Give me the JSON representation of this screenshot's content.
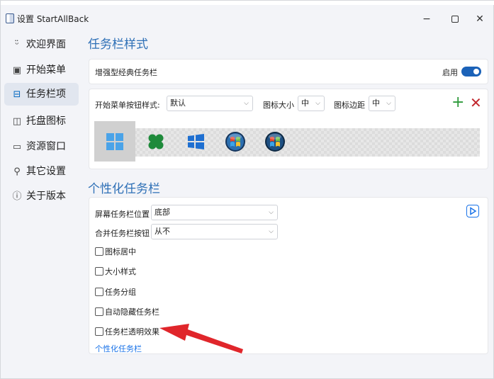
{
  "window": {
    "title": "设置 StartAllBack",
    "minimize": "−",
    "close": "✕"
  },
  "sidebar": {
    "items": [
      {
        "label": "欢迎界面",
        "icon": "smile-icon",
        "glyph": "ᵕ̈"
      },
      {
        "label": "开始菜单",
        "icon": "start-menu-icon",
        "glyph": "▣"
      },
      {
        "label": "任务栏项",
        "icon": "taskbar-icon",
        "glyph": "⊟",
        "active": true
      },
      {
        "label": "托盘图标",
        "icon": "tray-icon",
        "glyph": "◫"
      },
      {
        "label": "资源窗口",
        "icon": "explorer-icon",
        "glyph": "▭"
      },
      {
        "label": "其它设置",
        "icon": "wrench-icon",
        "glyph": "⚲"
      },
      {
        "label": "关于版本",
        "icon": "info-icon",
        "glyph": "ⓘ"
      }
    ]
  },
  "taskbar_style": {
    "section_title": "任务栏样式",
    "classic_label": "增强型经典任务栏",
    "classic_toggle_label": "启用",
    "classic_enabled": true,
    "start_button_style_label": "开始菜单按钮样式:",
    "start_button_style_value": "默认",
    "icon_size_label": "图标大小",
    "icon_size_value": "中",
    "icon_margin_label": "图标边距",
    "icon_margin_value": "中",
    "add_label": "+",
    "remove_label": "✕",
    "styles": [
      "windows-11-start-icon",
      "clover-start-icon",
      "windows-10-start-icon",
      "vista-orb-start-icon",
      "windows-7-orb-start-icon"
    ],
    "selected_style_index": 0
  },
  "personalize": {
    "section_title": "个性化任务栏",
    "position_label": "屏幕任务栏位置",
    "position_value": "底部",
    "combine_label": "合并任务栏按钮",
    "combine_value": "从不",
    "checkboxes": [
      {
        "label": "图标居中",
        "checked": false
      },
      {
        "label": "大小样式",
        "checked": false
      },
      {
        "label": "任务分组",
        "checked": false
      },
      {
        "label": "自动隐藏任务栏",
        "checked": false
      },
      {
        "label": "任务栏透明效果",
        "checked": false
      }
    ],
    "link_label": "个性化任务栏"
  },
  "colors": {
    "accent": "#2d6fb6",
    "toggle": "#1b62b8",
    "link": "#1a73e8",
    "add": "#2e9a3b",
    "remove": "#c1272d",
    "annotation_arrow": "#e0262b"
  }
}
